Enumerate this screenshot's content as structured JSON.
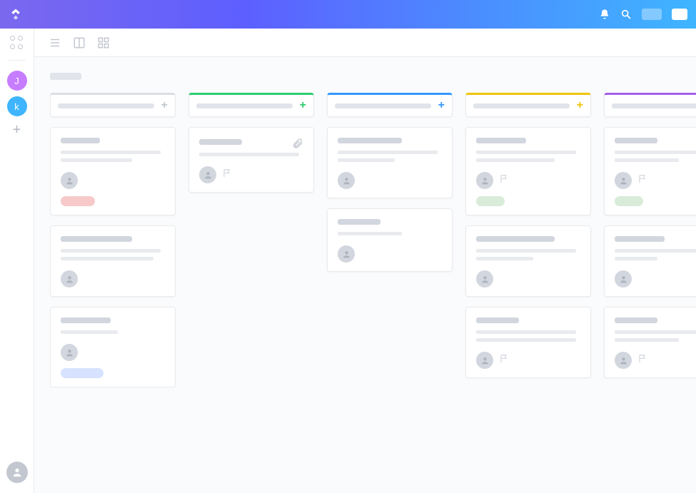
{
  "sidebar": {
    "avatars": [
      {
        "initial": "J",
        "color": "purple"
      },
      {
        "initial": "k",
        "color": "blue"
      }
    ]
  },
  "columns": [
    {
      "accent": "#dadde3",
      "plus_color": "#c3c7cf",
      "cards": [
        {
          "title_w": "w55",
          "lines": [
            "w140",
            "w100"
          ],
          "avatar": true,
          "flag": false,
          "tag": "red"
        },
        {
          "title_w": "w100",
          "lines": [
            "w140",
            "w130"
          ],
          "avatar": true,
          "flag": false
        },
        {
          "title_w": "w70",
          "lines": [
            "w80"
          ],
          "avatar": true,
          "flag": false,
          "tag": "blue"
        }
      ]
    },
    {
      "accent": "#2ecc71",
      "plus_color": "#2ecc71",
      "cards": [
        {
          "title_w": "w60",
          "attach": true,
          "lines": [
            "w140"
          ],
          "avatar": true,
          "flag": true
        }
      ]
    },
    {
      "accent": "#3498ff",
      "plus_color": "#3498ff",
      "cards": [
        {
          "title_w": "w90",
          "lines": [
            "w140",
            "w80"
          ],
          "avatar": true,
          "flag": false
        },
        {
          "title_w": "w60",
          "lines": [
            "w90"
          ],
          "avatar": true,
          "flag": false
        }
      ]
    },
    {
      "accent": "#f1c40f",
      "plus_color": "#f1c40f",
      "cards": [
        {
          "title_w": "w70",
          "lines": [
            "w140",
            "w110"
          ],
          "avatar": true,
          "flag": true,
          "tag": "green"
        },
        {
          "title_w": "w110",
          "lines": [
            "w140",
            "w80"
          ],
          "avatar": true,
          "flag": false
        },
        {
          "title_w": "w60",
          "lines": [
            "w140",
            "w140"
          ],
          "avatar": true,
          "flag": true
        }
      ]
    },
    {
      "accent": "#a55eea",
      "plus_color": "#a55eea",
      "cards": [
        {
          "title_w": "w60",
          "lines": [
            "w140",
            "w90"
          ],
          "avatar": true,
          "flag": true,
          "tag": "green"
        },
        {
          "title_w": "w70",
          "lines": [
            "w140",
            "w60"
          ],
          "avatar": true,
          "flag": false
        },
        {
          "title_w": "w60",
          "lines": [
            "w140",
            "w90"
          ],
          "avatar": true,
          "flag": true
        }
      ]
    }
  ]
}
